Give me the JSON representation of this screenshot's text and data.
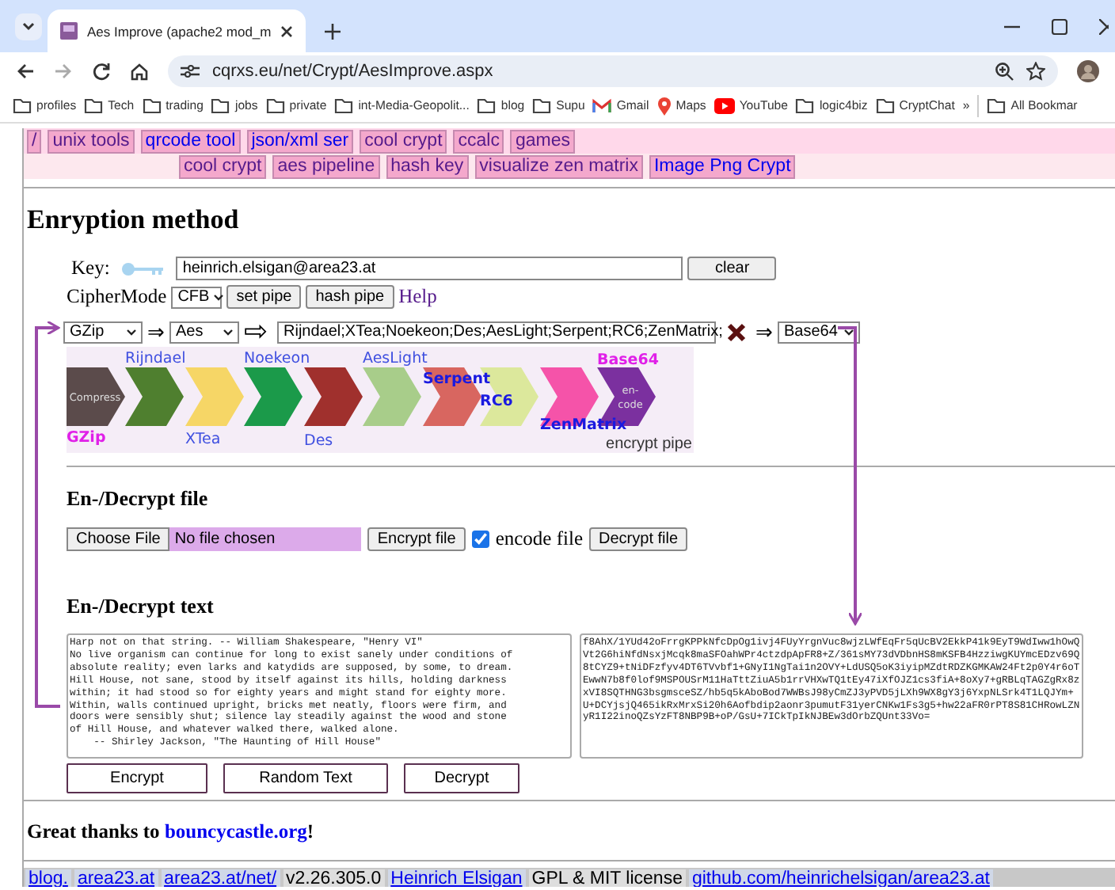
{
  "browser": {
    "tab_title": "Aes Improve (apache2 mod_m",
    "url": "cqrxs.eu/net/Crypt/AesImprove.aspx",
    "bookmarks": [
      {
        "label": "profiles",
        "kind": "folder"
      },
      {
        "label": "Tech",
        "kind": "folder"
      },
      {
        "label": "trading",
        "kind": "folder"
      },
      {
        "label": "jobs",
        "kind": "folder"
      },
      {
        "label": "private",
        "kind": "folder"
      },
      {
        "label": "int-Media-Geopolit...",
        "kind": "folder"
      },
      {
        "label": "blog",
        "kind": "folder"
      },
      {
        "label": "Supu",
        "kind": "folder"
      },
      {
        "label": "Gmail",
        "kind": "gmail"
      },
      {
        "label": "Maps",
        "kind": "maps"
      },
      {
        "label": "YouTube",
        "kind": "youtube"
      },
      {
        "label": "logic4biz",
        "kind": "folder"
      },
      {
        "label": "CryptChat",
        "kind": "folder"
      },
      {
        "label": "»",
        "kind": "more"
      },
      {
        "label": "All Bookmar",
        "kind": "folder"
      }
    ]
  },
  "nav": {
    "top_links": [
      {
        "label": "/",
        "visited": true
      },
      {
        "label": "unix tools",
        "visited": true
      },
      {
        "label": "qrcode tool",
        "visited": false
      },
      {
        "label": "json/xml ser",
        "visited": false
      },
      {
        "label": "cool crypt",
        "visited": true
      },
      {
        "label": "ccalc",
        "visited": true
      },
      {
        "label": "games",
        "visited": true
      }
    ],
    "sub_links": [
      {
        "label": "cool crypt",
        "visited": true
      },
      {
        "label": "aes pipeline",
        "visited": true
      },
      {
        "label": "hash key",
        "visited": true
      },
      {
        "label": "visualize zen matrix",
        "visited": true
      },
      {
        "label": "Image Png Crypt",
        "visited": false
      }
    ]
  },
  "method": {
    "heading": "Enryption method",
    "key_label": "Key:",
    "key_value": "heinrich.elsigan@area23.at",
    "clear_button": "clear",
    "ciphermode_label": "CipherMode",
    "ciphermode": "CFB",
    "buttons": [
      "set pipe",
      "hash pipe"
    ],
    "help_link": "Help",
    "pipe": {
      "input_select": "GZip",
      "arrow1": "⇒",
      "first_cipher": "Aes",
      "arrow2": "⇨",
      "sequence": "Rijndael;XTea;Noekeon;Des;AesLight;Serpent;RC6;ZenMatrix;",
      "arrow3": "⇒",
      "output_select": "Base64"
    },
    "pipeline_image": {
      "caption": "encrypt pipe",
      "stages": [
        {
          "label": "GZip",
          "color": "#5b4b4b",
          "inner": [
            "Compress"
          ]
        },
        {
          "label": "Rijndael",
          "color": "#4f7f2f"
        },
        {
          "label": "XTea",
          "color": "#f6d666"
        },
        {
          "label": "Noekeon",
          "color": "#1b9a4a"
        },
        {
          "label": "Des",
          "color": "#a0302d"
        },
        {
          "label": "AesLight",
          "color": "#a8cd8a"
        },
        {
          "label": "Serpent",
          "color": "#d86660"
        },
        {
          "label": "RC6",
          "color": "#dce89c"
        },
        {
          "label": "ZenMatrix",
          "color": "#f553a9"
        },
        {
          "label": "Base64",
          "color": "#7b309f",
          "inner": [
            "en-",
            "code"
          ]
        }
      ]
    }
  },
  "file": {
    "heading": "En-/Decrypt file",
    "choose_button": "Choose File",
    "file_status": "No file chosen",
    "encrypt_button": "Encrypt file",
    "encode_checked": true,
    "encode_label": "encode file",
    "decrypt_button": "Decrypt file"
  },
  "text": {
    "heading": "En-/Decrypt text",
    "plaintext": "Harp not on that string. -- William Shakespeare, \"Henry VI\"\nNo live organism can continue for long to exist sanely under conditions of\nabsolute reality; even larks and katydids are supposed, by some, to dream.\nHill House, not sane, stood by itself against its hills, holding darkness\nwithin; it had stood so for eighty years and might stand for eighty more.\nWithin, walls continued upright, bricks met neatly, floors were firm, and\ndoors were sensibly shut; silence lay steadily against the wood and stone\nof Hill House, and whatever walked there, walked alone.\n    -- Shirley Jackson, \"The Haunting of Hill House\"",
    "ciphertext": "f8AhX/1YUd42oFrrgKPPkNfcDpOg1ivj4FUyYrgnVuc8wjzLWfEqFr5qUcBV2EkkP41k9EyT9WdIww1hOwQ\nVt2G6hiNfdNsxjMcqk8maSFOahWPr4ctzdpApFR8+Z/361sMY73dVDbnHS8mKSFB4HzziwgKUYmcEDzv69Q\n8tCYZ9+tNiDFzfyv4DT6TVvbf1+GNyI1NgTai1n2OVY+LdUSQ5oK3iyipMZdtRDZKGMKAW24Ft2p0Y4r6oT\nEwwN7b8f0lof9MSPOUSrM11HaTttZiuA5b1rrVHXwTQ1tEy47iXfOJZ1cs3fiA+8oXy7+gRBLqTAGZgRx8z\nxVI8SQTHNG3bsgmsceSZ/hb5q5kAboBod7WWBsJ98yCmZJ3yPVD5jLXh9WX8gY3j6YxpNLSrk4T1LQJYm+\nU+DCYjsjQ465ikRxMrxSi20h6Aofbdip2aonr3pumutF31yerCNKw1Fs3g5+hw22aFR0rPT8S81CHRowLZN\nyR1I22inoQZsYzFT8NBP9B+oP/GsU+7ICkTpIkNJBEw3dOrbZQUnt33Vo=",
    "buttons": [
      "Encrypt",
      "Random Text",
      "Decrypt"
    ]
  },
  "thanks": {
    "prefix": "Great thanks to ",
    "link": "bouncycastle.org",
    "suffix": "!"
  },
  "footer": {
    "items": [
      {
        "label": "blog.",
        "kind": "link"
      },
      {
        "label": "area23.at",
        "kind": "link"
      },
      {
        "label": "area23.at/net/",
        "kind": "link"
      },
      {
        "label": "v2.26.305.0",
        "kind": "text"
      },
      {
        "label": "Heinrich Elsigan",
        "kind": "link"
      },
      {
        "label": "GPL & MIT license",
        "kind": "text"
      },
      {
        "label": "github.com/heinrichelsigan/area23.at",
        "kind": "link"
      }
    ]
  }
}
